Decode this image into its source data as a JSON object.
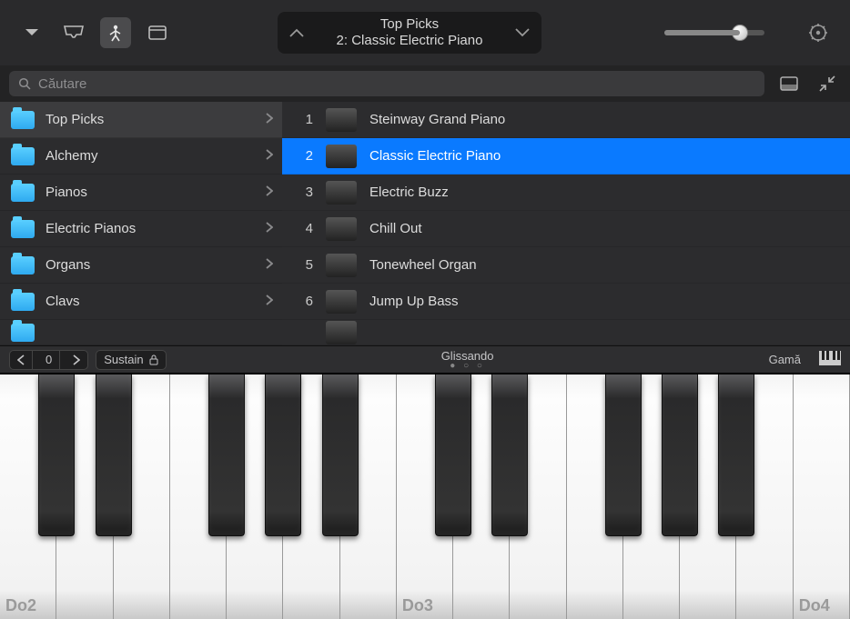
{
  "header": {
    "track_title": "Top Picks",
    "track_subtitle": "2: Classic Electric Piano"
  },
  "search": {
    "placeholder": "Căutare"
  },
  "categories": [
    {
      "label": "Top Picks",
      "selected": true
    },
    {
      "label": "Alchemy"
    },
    {
      "label": "Pianos"
    },
    {
      "label": "Electric Pianos"
    },
    {
      "label": "Organs"
    },
    {
      "label": "Clavs"
    }
  ],
  "patches": [
    {
      "n": "1",
      "label": "Steinway Grand Piano"
    },
    {
      "n": "2",
      "label": "Classic Electric Piano",
      "selected": true
    },
    {
      "n": "3",
      "label": "Electric Buzz"
    },
    {
      "n": "4",
      "label": "Chill Out"
    },
    {
      "n": "5",
      "label": "Tonewheel Organ"
    },
    {
      "n": "6",
      "label": "Jump Up Bass"
    }
  ],
  "kb_toolbar": {
    "octave": "0",
    "sustain": "Sustain",
    "mode": "Glissando",
    "scale": "Gamă"
  },
  "keyboard": {
    "labels": {
      "0": "Do2",
      "7": "Do3",
      "14": "Do4"
    }
  }
}
